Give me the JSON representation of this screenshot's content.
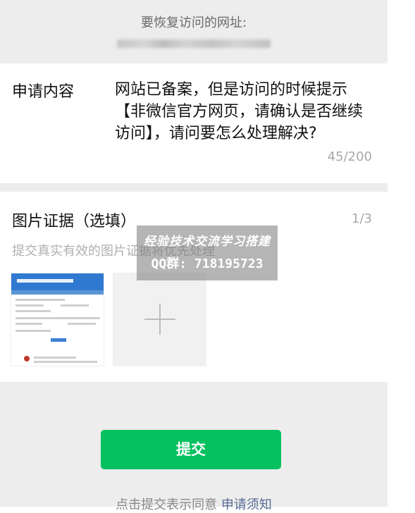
{
  "restore_section": {
    "label": "要恢复访问的网址:",
    "url_blurred": ""
  },
  "request": {
    "label": "申请内容",
    "text": "网站已备案，但是访问的时候提示【非微信官方网页，请确认是否继续访问】，请问要怎么处理解决?",
    "counter": "45/200"
  },
  "evidence": {
    "title": "图片证据（选填）",
    "count": "1/3",
    "hint": "提交真实有效的图片证据将优先处理"
  },
  "watermark": {
    "line1": "经验技术交流学习搭建",
    "line2": "QQ群: 718195723"
  },
  "footer": {
    "submit_label": "提交",
    "agree_prefix": "点击提交表示同意",
    "agree_link": "申请须知"
  },
  "colors": {
    "accent": "#07c160",
    "link": "#576b95",
    "background": "#ededed"
  }
}
